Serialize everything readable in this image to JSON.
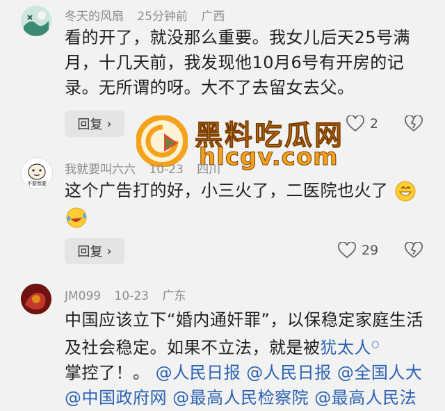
{
  "comments": [
    {
      "username": "冬天的风扇",
      "time": "25分钟前",
      "location": "广西",
      "lines": [
        "看的开了，就没那么重要。我女儿后天25号满",
        "月，十几天前，我发现他10月6号有开房的记",
        "录。无所谓的呀。大不了去留女去父。"
      ],
      "reply_label": "回复",
      "likes": "2"
    },
    {
      "username": "我就要叫六六",
      "time": "10-23",
      "location": "四川",
      "lines": [
        "这个广告打的好，小三火了，二医院也火了"
      ],
      "reply_label": "回复",
      "likes": "29"
    },
    {
      "username": "JM099",
      "time": "10-23",
      "location": "广东",
      "line1": "中国应该立下“婚内通奸罪”，以保稳定家庭生活",
      "line2": "及社会稳定。如果不立法，就是被",
      "link_text": "犹太人",
      "line3a": "掌控了！。",
      "mentions": [
        "@人民日报",
        "@人民日报",
        "@全国人大",
        "@中国政府网",
        "@最高人民检察院",
        "@最高人民法"
      ]
    }
  ],
  "avatar_caption": "不要我要",
  "watermark": {
    "title": "黑料吃瓜网",
    "url": "hlcgv.com"
  },
  "colors": {
    "link": "#2a62b3",
    "background": "#f2f2f2",
    "watermark": "#f4a21c"
  }
}
